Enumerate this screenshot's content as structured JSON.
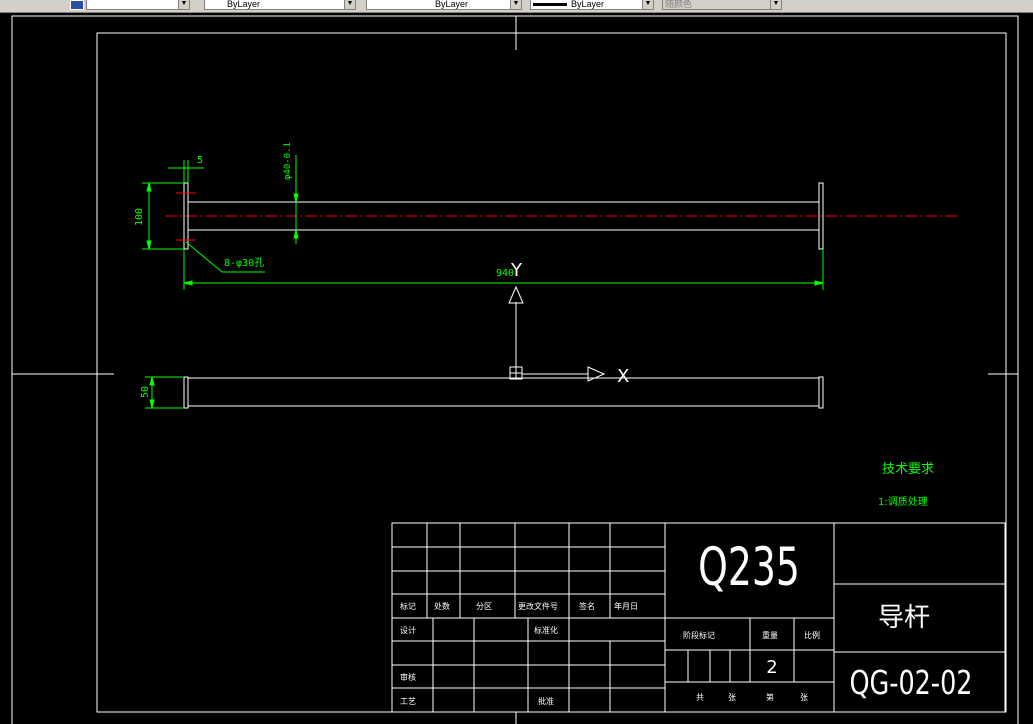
{
  "toolbar": {
    "layer_combo": "",
    "color_combo": "ByLayer",
    "linetype_combo": "ByLayer",
    "lineweight_combo": "ByLayer",
    "plotstyle_combo": "随颜色"
  },
  "drawing": {
    "dim_top_5": "5",
    "dim_phi": "φ40-0.1",
    "dim_100": "100",
    "dim_holes": "8-φ30孔",
    "dim_940": "940",
    "dim_50": "50",
    "ucs_y": "Y",
    "ucs_x": "X",
    "tech_title": "技术要求",
    "tech_item": "1:调质处理"
  },
  "title_block": {
    "material": "Q235",
    "part_name": "导杆",
    "drawing_no": "QG-02-02",
    "scale_value": "2",
    "rev_labels": [
      "标记",
      "处数",
      "分区",
      "更改文件号",
      "签名",
      "年月日"
    ],
    "design": "设计",
    "standardize": "标准化",
    "review": "审核",
    "process": "工艺",
    "approve": "批准",
    "stage_mark": "阶段标记",
    "weight": "重量",
    "scale": "比例",
    "sheet_labels": [
      "共",
      "张",
      "第",
      "张"
    ]
  },
  "colors": {
    "background": "#000000",
    "lines": "#ffffff",
    "dimension": "#00ff00",
    "centerline": "#ff0000"
  }
}
